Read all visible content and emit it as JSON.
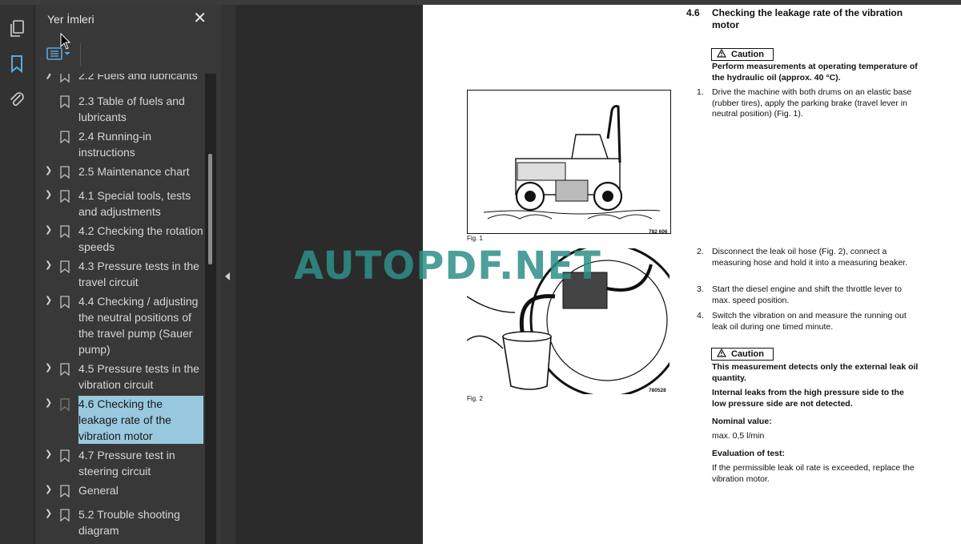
{
  "panel": {
    "title": "Yer İmleri",
    "close": "✕"
  },
  "bookmarks": [
    {
      "label": "2.2 Fuels and lubricants",
      "expandable": true,
      "selected": false
    },
    {
      "label": "2.3 Table of fuels and lubricants",
      "expandable": false,
      "selected": false
    },
    {
      "label": "2.4 Running-in instructions",
      "expandable": false,
      "selected": false
    },
    {
      "label": "2.5 Maintenance chart",
      "expandable": true,
      "selected": false
    },
    {
      "label": "4.1 Special tools, tests and adjustments",
      "expandable": true,
      "selected": false
    },
    {
      "label": "4.2 Checking the rotation speeds",
      "expandable": true,
      "selected": false
    },
    {
      "label": "4.3 Pressure tests in the travel circuit",
      "expandable": true,
      "selected": false
    },
    {
      "label": "4.4 Checking / adjusting the neutral positions of the travel pump (Sauer pump)",
      "expandable": true,
      "selected": false
    },
    {
      "label": "4.5 Pressure tests in the vibration circuit",
      "expandable": true,
      "selected": false
    },
    {
      "label": "4.6 Checking the leakage rate of the vibration motor",
      "expandable": true,
      "selected": true
    },
    {
      "label": "4.7 Pressure test in steering circuit",
      "expandable": true,
      "selected": false
    },
    {
      "label": "General",
      "expandable": true,
      "selected": false
    },
    {
      "label": "5.2 Trouble shooting diagram",
      "expandable": true,
      "selected": false
    }
  ],
  "document": {
    "section_number": "4.6",
    "section_title": "Checking the leakage rate of the vibration motor",
    "caution_label": "Caution",
    "caution1_text": "Perform measurements at operating temperature of the hydraulic oil (approx. 40 °C).",
    "steps": [
      {
        "num": "1.",
        "text": "Drive the machine with both drums on an elastic base (rubber tires), apply the parking brake (travel lever in neutral position) (Fig. 1)."
      },
      {
        "num": "2.",
        "text": "Disconnect the leak oil hose (Fig. 2), connect a measuring hose and hold it into a measuring beaker."
      },
      {
        "num": "3.",
        "text": "Start the diesel engine and shift the throttle lever to max. speed position."
      },
      {
        "num": "4.",
        "text": "Switch the vibration on and measure the running out leak oil during one timed minute."
      }
    ],
    "caution2_text1": "This measurement detects only the external leak oil quantity.",
    "caution2_text2": "Internal leaks from the high pressure side to the low pressure side are not detected.",
    "nominal_label": "Nominal value:",
    "nominal_value": "max. 0,5 l/min",
    "evaluation_label": "Evaluation of test:",
    "evaluation_text": "If the permissible leak oil rate is exceeded, replace the vibration motor.",
    "fig1_caption": "Fig. 1",
    "fig1_id": "782 606",
    "fig2_caption": "Fig. 2",
    "fig2_id": "780528"
  },
  "watermark": "AUTOPDF.NET",
  "icons": {
    "pages": "pages-icon",
    "bookmarks": "bookmark-icon",
    "attachments": "paperclip-icon",
    "options": "list-options-icon"
  }
}
